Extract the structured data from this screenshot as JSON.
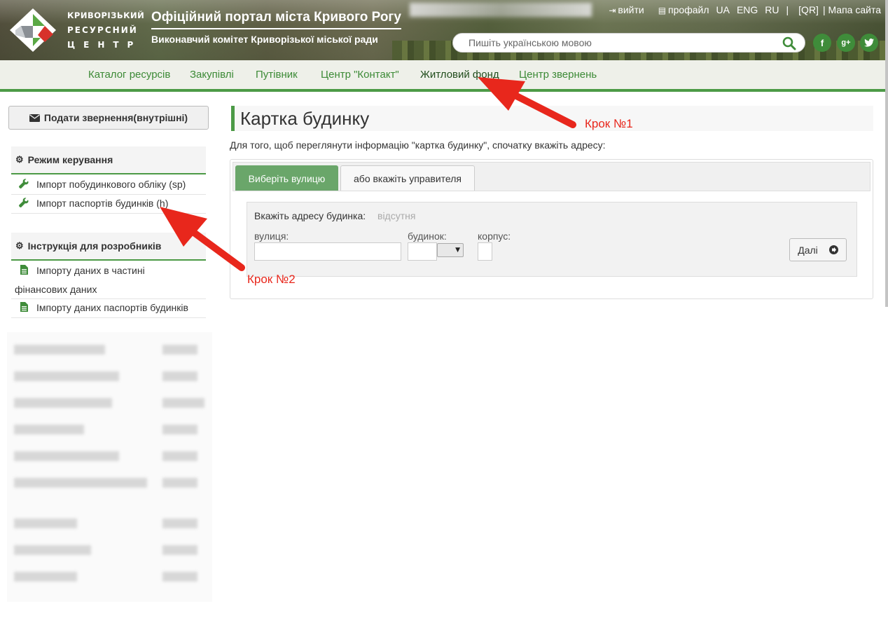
{
  "header": {
    "logo_lines": [
      "КРИВОРІЗЬКИЙ",
      "РЕСУРСНИЙ",
      "ЦЕНТР"
    ],
    "portal_title": "Офіційний портал міста Кривого Рогу",
    "portal_subtitle": "Виконавчий комітет Криворізької міської ради",
    "logout": "вийти",
    "profile": "профайл",
    "lang_ua": "UA",
    "lang_eng": "ENG",
    "lang_ru": "RU",
    "sep1": "|",
    "qr": "[QR]",
    "sitemap": "| Мапа сайта",
    "search_placeholder": "Пишіть українською мовою",
    "social": [
      {
        "name": "facebook",
        "glyph": "f"
      },
      {
        "name": "google-plus",
        "glyph": "g+"
      },
      {
        "name": "twitter",
        "glyph": "t"
      }
    ]
  },
  "nav": {
    "items": [
      {
        "label": "Каталог ресурсів",
        "active": false
      },
      {
        "label": "Закупівлі",
        "active": false
      },
      {
        "label": "Путівник",
        "active": false
      },
      {
        "label": "Центр \"Контакт\"",
        "active": false
      },
      {
        "label": "Житловий фонд",
        "active": true
      },
      {
        "label": "Центр звернень",
        "active": false
      }
    ]
  },
  "sidebar": {
    "appeal_button": "Подати звернення(внутрішні)",
    "section1": {
      "title": "Режим керування",
      "items": [
        "Імпорт побудинкового обліку (sp)",
        "Імпорт паспортів будинків (h)"
      ]
    },
    "section2": {
      "title": "Інструкція для розробників",
      "items": [
        {
          "line1": "Імпорту даних в частині",
          "line2": "фінансових даних"
        },
        {
          "line1": "Імпорту даних паспортів будинків"
        }
      ]
    }
  },
  "main": {
    "title": "Картка будинку",
    "intro": "Для того, щоб переглянути інформацію \"картка будинку\", спочатку вкажіть адресу:",
    "tabs": [
      "Виберіть вулицю",
      "або вкажіть управителя"
    ],
    "address_label": "Вкажіть адресу будинка:",
    "address_value": "відсутня",
    "field_street": "вулиця:",
    "field_house": "будинок:",
    "field_block": "корпус:",
    "next_button": "Далі"
  },
  "annotations": {
    "step1": "Крок №1",
    "step2": "Крок №2"
  },
  "colors": {
    "accent_green": "#4c9a46",
    "nav_text": "#3c8a36",
    "arrow_red": "#e8271c",
    "active_tab": "#6aa66a"
  }
}
